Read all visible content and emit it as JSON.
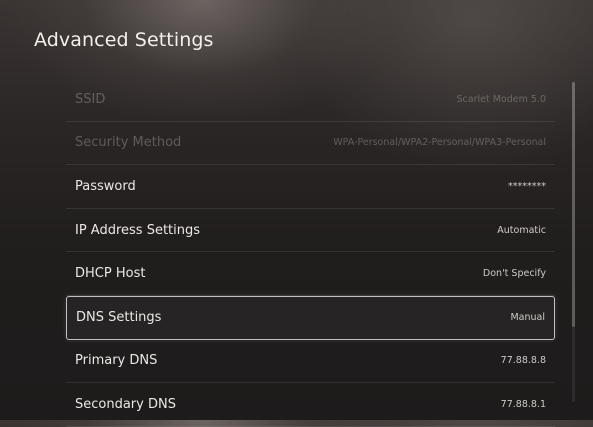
{
  "header": {
    "title": "Advanced Settings"
  },
  "settings": {
    "rows": [
      {
        "label": "SSID",
        "value": "Scarlet Modem 5.0",
        "enabled": false
      },
      {
        "label": "Security Method",
        "value": "WPA-Personal/WPA2-Personal/WPA3-Personal",
        "enabled": false
      },
      {
        "label": "Password",
        "value": "********",
        "enabled": true
      },
      {
        "label": "IP Address Settings",
        "value": "Automatic",
        "enabled": true
      },
      {
        "label": "DHCP Host",
        "value": "Don't Specify",
        "enabled": true
      },
      {
        "label": "DNS Settings",
        "value": "Manual",
        "enabled": true,
        "focused": true
      },
      {
        "label": "Primary DNS",
        "value": "77.88.8.8",
        "enabled": true
      },
      {
        "label": "Secondary DNS",
        "value": "77.88.8.1",
        "enabled": true
      }
    ]
  },
  "colors": {
    "focus_border": "#ffffff",
    "text_primary": "#ece8e4",
    "text_disabled": "#5a5552"
  }
}
